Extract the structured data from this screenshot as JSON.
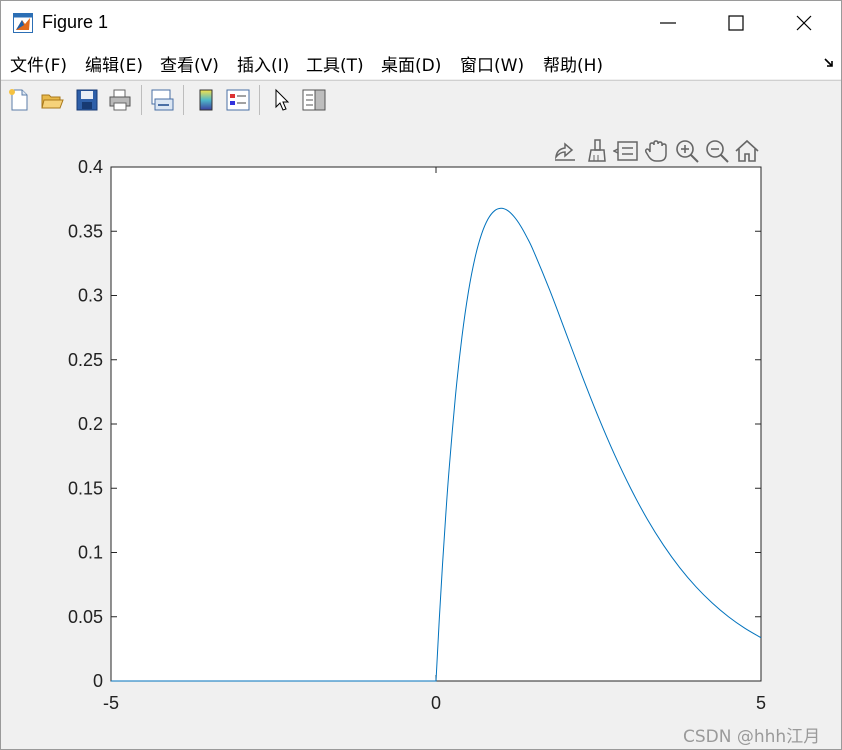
{
  "window": {
    "title": "Figure 1"
  },
  "menu": [
    {
      "label": "文件(F)"
    },
    {
      "label": "编辑(E)"
    },
    {
      "label": "查看(V)"
    },
    {
      "label": "插入(I)"
    },
    {
      "label": "工具(T)"
    },
    {
      "label": "桌面(D)"
    },
    {
      "label": "窗口(W)"
    },
    {
      "label": "帮助(H)"
    }
  ],
  "toolbar_icons": [
    "new-figure-icon",
    "open-file-icon",
    "save-icon",
    "print-icon",
    "link-plot-icon",
    "colorbar-icon",
    "legend-icon",
    "edit-plot-arrow-icon",
    "property-inspector-icon"
  ],
  "axes_toolbar_icons": [
    "export-icon",
    "brush-icon",
    "data-tips-icon",
    "pan-hand-icon",
    "zoom-in-icon",
    "zoom-out-icon",
    "restore-view-home-icon"
  ],
  "chart_data": {
    "type": "line",
    "title": "",
    "xlabel": "",
    "ylabel": "",
    "xlim": [
      -5,
      5
    ],
    "ylim": [
      0,
      0.4
    ],
    "x_ticks": [
      -5,
      0,
      5
    ],
    "x_tick_labels": [
      "-5",
      "0",
      "5"
    ],
    "y_ticks": [
      0,
      0.05,
      0.1,
      0.15,
      0.2,
      0.25,
      0.3,
      0.35,
      0.4
    ],
    "y_tick_labels": [
      "0",
      "0.05",
      "0.1",
      "0.15",
      "0.2",
      "0.25",
      "0.3",
      "0.35",
      "0.4"
    ],
    "grid": false,
    "series": [
      {
        "color": "#0072bd",
        "x": [
          -5,
          -4,
          -3,
          -2,
          -1,
          0,
          0.05,
          0.1,
          0.15,
          0.2,
          0.3,
          0.4,
          0.5,
          0.6,
          0.7,
          0.8,
          0.9,
          1.0,
          1.1,
          1.2,
          1.3,
          1.4,
          1.5,
          1.75,
          2.0,
          2.25,
          2.5,
          2.75,
          3.0,
          3.25,
          3.5,
          3.75,
          4.0,
          4.25,
          4.5,
          4.75,
          5.0
        ],
        "y": [
          0,
          0,
          0,
          0,
          0,
          0,
          0.0476,
          0.0905,
          0.1291,
          0.1637,
          0.2222,
          0.2681,
          0.3033,
          0.3293,
          0.3476,
          0.3595,
          0.3659,
          0.3679,
          0.3662,
          0.3614,
          0.3543,
          0.3452,
          0.3347,
          0.3041,
          0.2707,
          0.2371,
          0.2052,
          0.1758,
          0.1494,
          0.126,
          0.1057,
          0.0882,
          0.0733,
          0.0607,
          0.05,
          0.0411,
          0.0337
        ]
      }
    ]
  },
  "watermark": "CSDN @hhh江月"
}
